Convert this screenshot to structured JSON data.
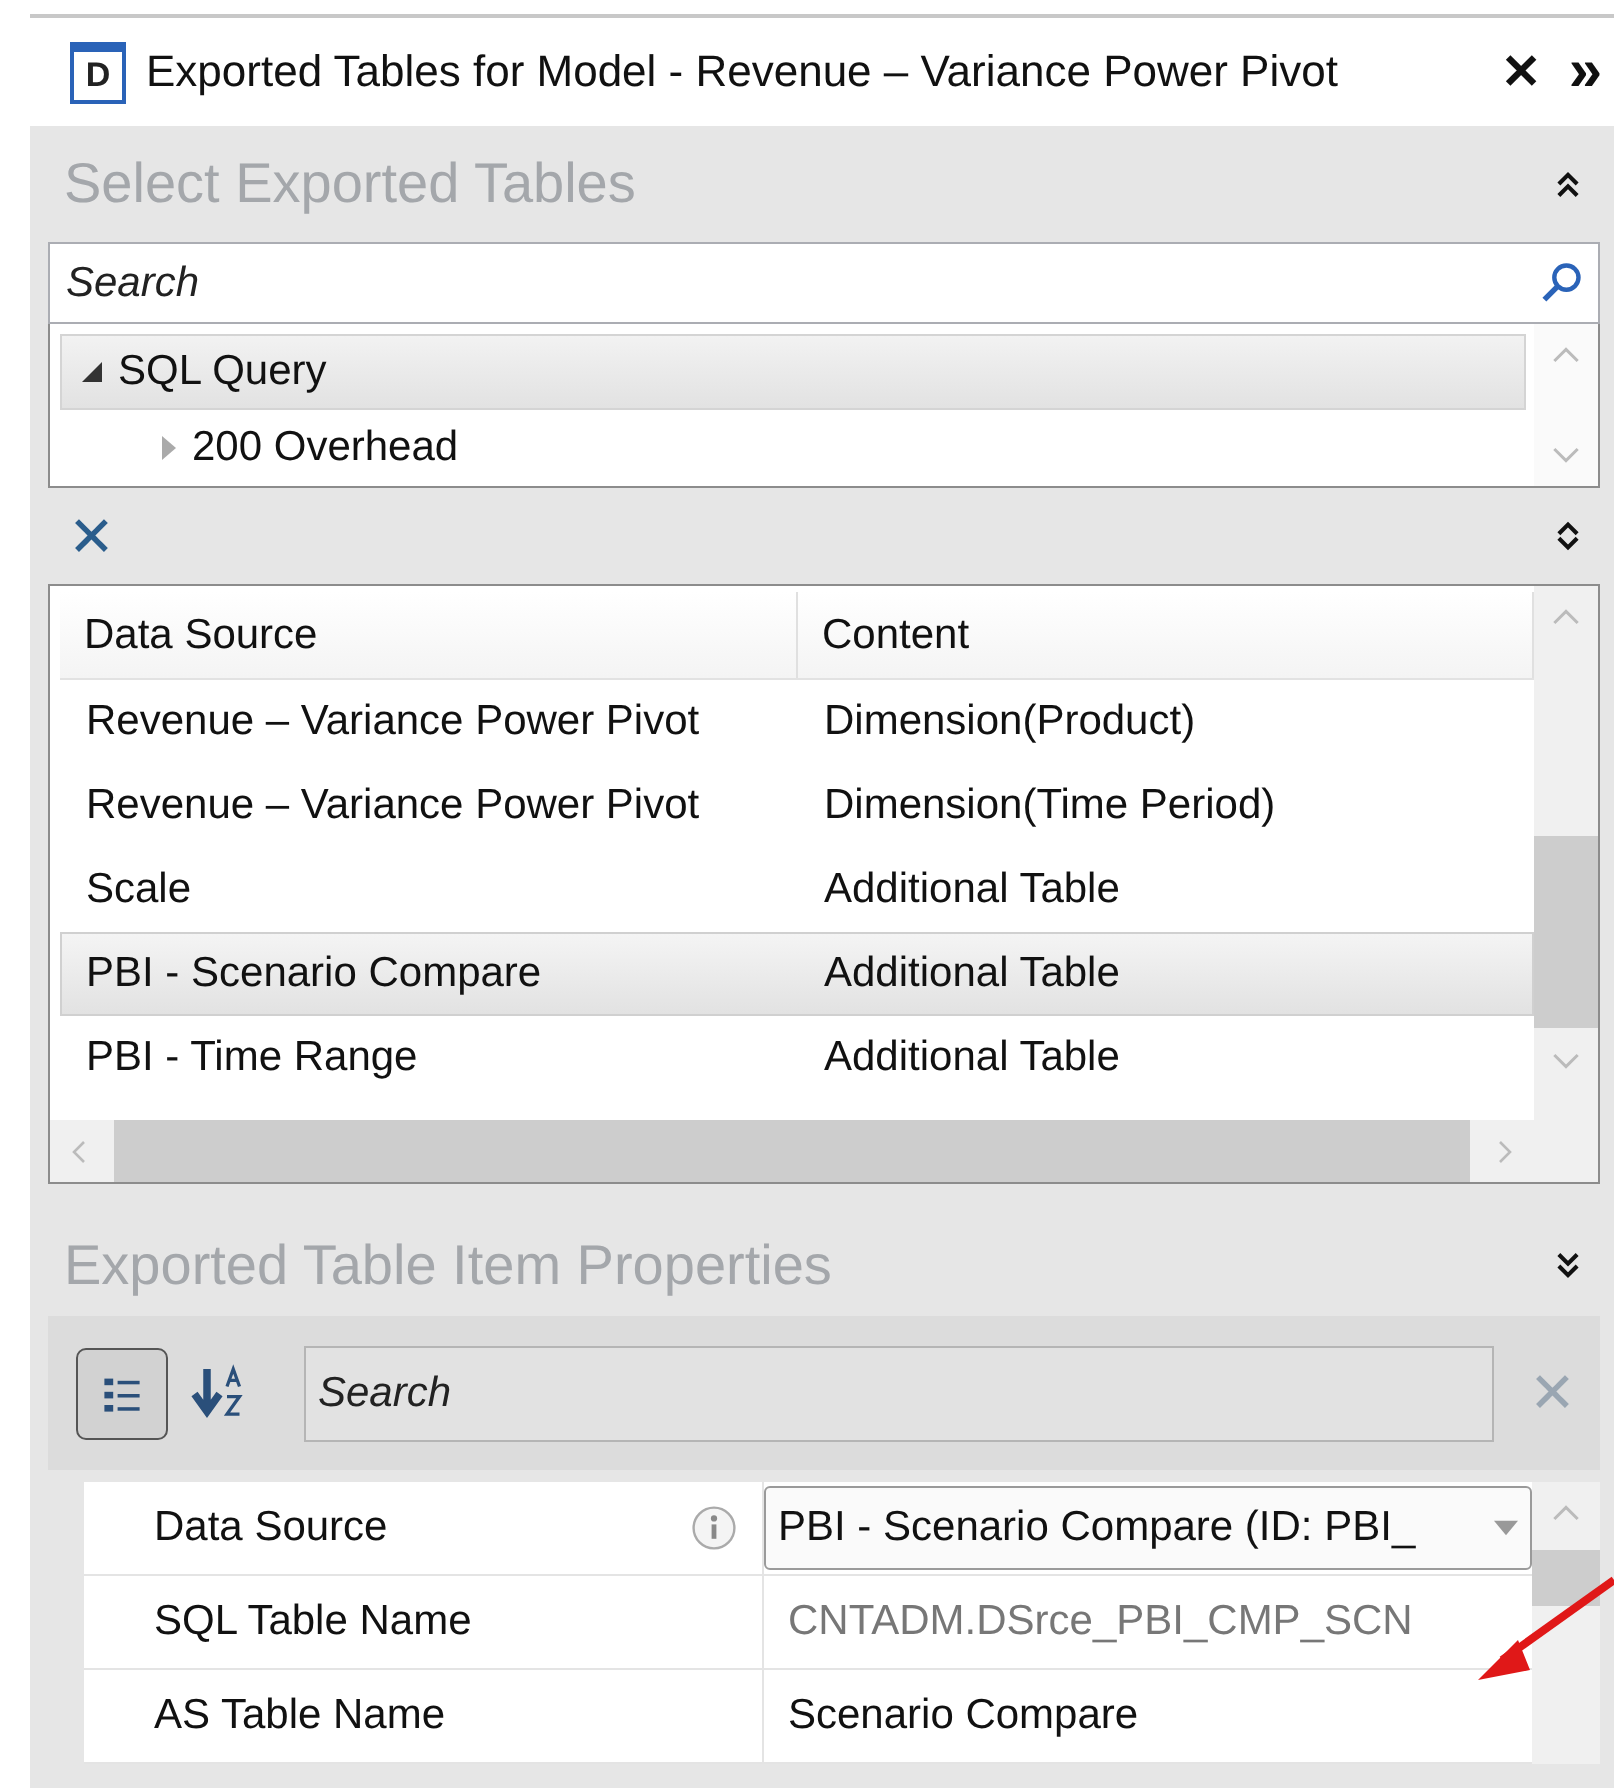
{
  "window": {
    "icon_letter": "D",
    "title": "Exported Tables for Model - Revenue – Variance Power Pivot",
    "close": "✕",
    "overflow": "»"
  },
  "select_section": {
    "title": "Select Exported Tables",
    "expanded": true,
    "search": {
      "placeholder": "Search"
    },
    "tree": [
      {
        "label": "SQL Query",
        "expanded": true,
        "selected": true,
        "children": [
          {
            "label": "200 Overhead",
            "expanded": false,
            "selected": false
          }
        ]
      }
    ]
  },
  "tables_section": {
    "remove": "✕",
    "columns": [
      "Data Source",
      "Content"
    ],
    "rows": [
      {
        "data_source": "Revenue – Variance Power Pivot",
        "content": "Dimension(Product)",
        "selected": false
      },
      {
        "data_source": "Revenue – Variance Power Pivot",
        "content": "Dimension(Time Period)",
        "selected": false
      },
      {
        "data_source": "Scale",
        "content": "Additional Table",
        "selected": false
      },
      {
        "data_source": "PBI - Scenario Compare",
        "content": "Additional Table",
        "selected": true
      },
      {
        "data_source": "PBI - Time Range",
        "content": "Additional Table",
        "selected": false
      }
    ]
  },
  "properties_section": {
    "title": "Exported Table Item Properties",
    "expanded": false,
    "categorized": true,
    "search": {
      "placeholder": "Search"
    },
    "properties": [
      {
        "name": "Data Source",
        "kind": "dropdown",
        "info": true,
        "value": "PBI - Scenario Compare (ID: PBI_"
      },
      {
        "name": "SQL Table Name",
        "kind": "readonly",
        "info": false,
        "value": "CNTADM.DSrce_PBI_CMP_SCN"
      },
      {
        "name": "AS Table Name",
        "kind": "text",
        "info": false,
        "value": "Scenario Compare"
      }
    ]
  }
}
